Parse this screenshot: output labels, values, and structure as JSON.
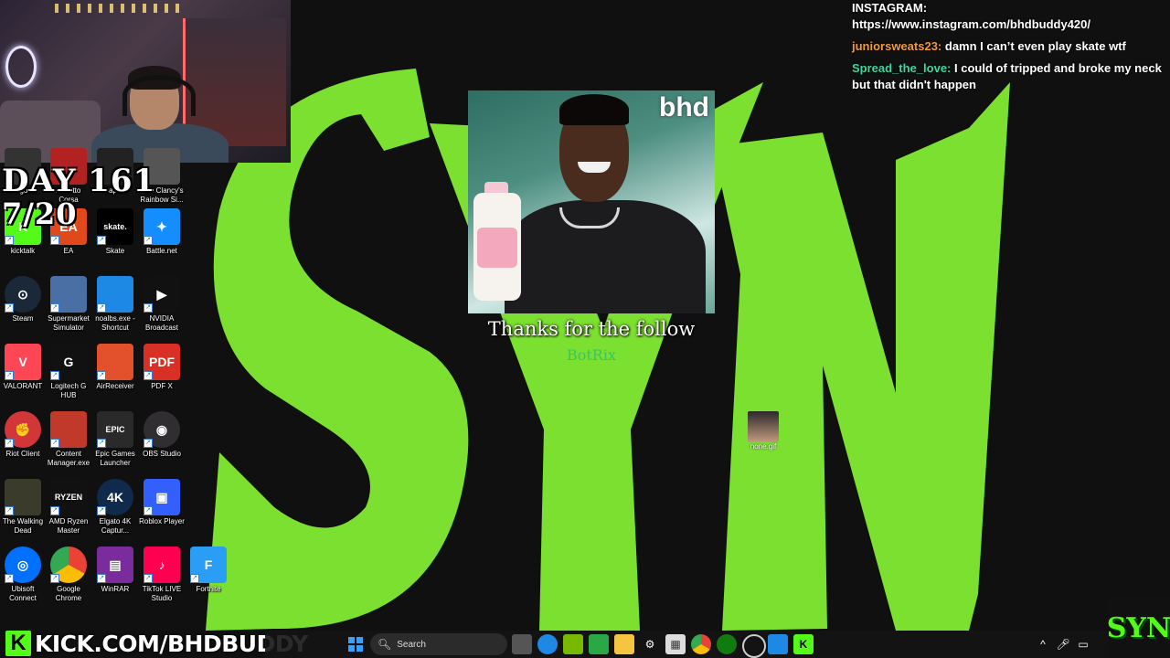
{
  "overlay": {
    "day_label": "DAY 161",
    "date_label": "7/20"
  },
  "chat": {
    "messages": [
      {
        "user": "",
        "text": "INSTAGRAM: https://www.instagram.com/bhdbuddy420/"
      },
      {
        "user": "juniorsweats23:",
        "text": "damn I can’t even play skate wtf"
      },
      {
        "user": "Spread_the_love:",
        "text": "I could of tripped and broke my neck but that didn't happen"
      }
    ]
  },
  "alert": {
    "brand": "bhd",
    "title": "Thanks for the follow",
    "subtitle": "BotRix"
  },
  "desktop": {
    "icons": [
      {
        "label": "Dragon...",
        "icon": "dragon-icon"
      },
      {
        "label": "Assetto Corsa",
        "icon": "assetto-icon"
      },
      {
        "label": "Capcut",
        "icon": "capcut-icon"
      },
      {
        "label": "Tom Clancy's Rainbow Si...",
        "icon": "rainbow-six-icon"
      },
      {
        "label": "kicktalk",
        "icon": "kicktalk-icon"
      },
      {
        "label": "EA",
        "icon": "ea-icon"
      },
      {
        "label": "Skate",
        "icon": "skate-icon"
      },
      {
        "label": "Battle.net",
        "icon": "battlenet-icon"
      },
      {
        "label": "Steam",
        "icon": "steam-icon"
      },
      {
        "label": "Supermarket Simulator",
        "icon": "supermarket-icon"
      },
      {
        "label": "noalbs.exe - Shortcut",
        "icon": "noalbs-icon"
      },
      {
        "label": "NVIDIA Broadcast",
        "icon": "nvidia-icon"
      },
      {
        "label": "VALORANT",
        "icon": "valorant-icon"
      },
      {
        "label": "Logitech G HUB",
        "icon": "logitech-icon"
      },
      {
        "label": "AirReceiver",
        "icon": "airreceiver-icon"
      },
      {
        "label": "PDF X",
        "icon": "pdfx-icon"
      },
      {
        "label": "Riot Client",
        "icon": "riot-icon"
      },
      {
        "label": "Content Manager.exe",
        "icon": "content-manager-icon"
      },
      {
        "label": "Epic Games Launcher",
        "icon": "epic-icon"
      },
      {
        "label": "OBS Studio",
        "icon": "obs-icon"
      },
      {
        "label": "The Walking Dead",
        "icon": "walking-dead-icon"
      },
      {
        "label": "AMD Ryzen Master",
        "icon": "ryzen-icon"
      },
      {
        "label": "Elgato 4K Captur...",
        "icon": "elgato-icon"
      },
      {
        "label": "Roblox Player",
        "icon": "roblox-icon"
      },
      {
        "label": "Ubisoft Connect",
        "icon": "ubisoft-icon"
      },
      {
        "label": "Google Chrome",
        "icon": "chrome-icon"
      },
      {
        "label": "WinRAR",
        "icon": "winrar-icon"
      },
      {
        "label": "TikTok LIVE Studio",
        "icon": "tiktok-icon"
      },
      {
        "label": "Fortnite",
        "icon": "fortnite-icon"
      }
    ],
    "file": {
      "label": "none.gif"
    }
  },
  "banner": {
    "logo": "K",
    "url": "KICK.COM/BHDBUDDY"
  },
  "taskbar": {
    "search_placeholder": "Search"
  },
  "badge": {
    "text": "SYN"
  },
  "colors": {
    "wallpaper_green": "#7be02f",
    "kick_green": "#53fc18",
    "chat_orange": "#f29a3a",
    "chat_teal": "#41d6a0"
  }
}
